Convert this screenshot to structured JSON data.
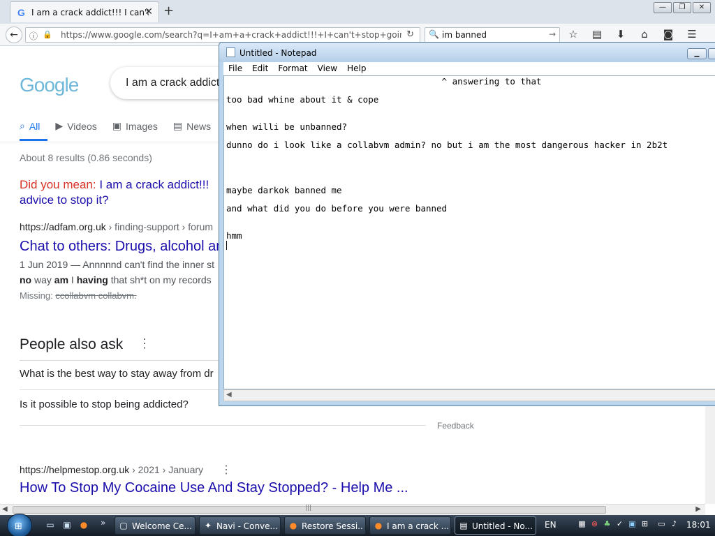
{
  "browser": {
    "tab_title": "I am a crack addict!!! I can't...",
    "new_tab_glyph": "+",
    "window_controls": [
      "—",
      "❐",
      "✕"
    ],
    "url": "https://www.google.com/search?q=I+am+a+crack+addict!!!+I+can't+stop+going+to",
    "search_value": "im banned"
  },
  "google": {
    "logo": "Google",
    "query": "I am a crack addict",
    "tabs": [
      {
        "label": "All",
        "icon": "magnifier-icon"
      },
      {
        "label": "Videos",
        "icon": "play-icon"
      },
      {
        "label": "Images",
        "icon": "image-icon"
      },
      {
        "label": "News",
        "icon": "newspaper-icon"
      }
    ],
    "stats": "About 8 results (0.86 seconds)",
    "did_you_mean_label": "Did you mean:",
    "did_you_mean_line1": "I am a crack addict!!!",
    "did_you_mean_line2": "advice to stop it?",
    "result1": {
      "cite_domain": "https://adfam.org.uk",
      "cite_path": " › finding-support › forum",
      "title": "Chat to others: Drugs, alcohol an",
      "snippet_line1": "1 Jun 2019 — Annnnnd can't find the inner st",
      "snippet_no": "no",
      "snippet_way": " way ",
      "snippet_am": "am",
      "snippet_i": " I ",
      "snippet_having": "having",
      "snippet_rest": " that sh*t on my records",
      "missing_label": "Missing: ",
      "missing_terms": "ccollabvm collabvm."
    },
    "paa_heading": "People also ask",
    "paa_dots": "⋮",
    "paa_questions": [
      "What is the best way to stay away from dr",
      "Is it possible to stop being addicted?"
    ],
    "feedback": "Feedback",
    "result2": {
      "cite_domain": "https://helpmestop.org.uk",
      "cite_path": " › 2021 › January",
      "title": "How To Stop My Cocaine Use And Stay Stopped? - Help Me ..."
    }
  },
  "notepad": {
    "title": "Untitled - Notepad",
    "menu": [
      "File",
      "Edit",
      "Format",
      "View",
      "Help"
    ],
    "lines": [
      "                                         ^ answering to that",
      "too bad whine about it & cope",
      "when willi be unbanned?",
      "dunno do i look like a collabvm admin? no but i am the most dangerous hacker in 2b2t",
      "maybe darkok banned me",
      "and what did you do before you were banned",
      "hmm"
    ]
  },
  "taskbar": {
    "tasks": [
      {
        "label": "Welcome Ce...",
        "icon": "welcome-center-icon"
      },
      {
        "label": "Navi - Conve...",
        "icon": "navi-icon"
      },
      {
        "label": "Restore Sessi...",
        "icon": "firefox-icon"
      },
      {
        "label": "I am a crack ...",
        "icon": "firefox-icon"
      },
      {
        "label": "Untitled - No...",
        "icon": "notepad-icon"
      }
    ],
    "language": "EN",
    "clock": "18:01"
  }
}
